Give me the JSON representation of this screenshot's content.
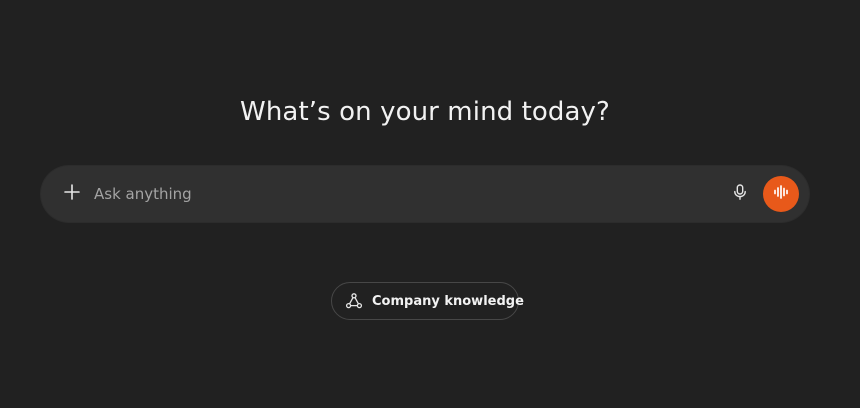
{
  "main": {
    "heading": "What’s on your mind today?"
  },
  "composer": {
    "placeholder": "Ask anything",
    "value": "",
    "icons": {
      "add": "plus-icon",
      "dictate": "microphone-icon",
      "voice": "voice-waveform-icon"
    },
    "voice_button_color": "#e8591a"
  },
  "chips": {
    "company_knowledge": {
      "label": "Company knowledge",
      "icon": "connections-icon"
    }
  },
  "colors": {
    "background": "#212121",
    "composer_background": "#303030",
    "accent": "#e8591a"
  }
}
